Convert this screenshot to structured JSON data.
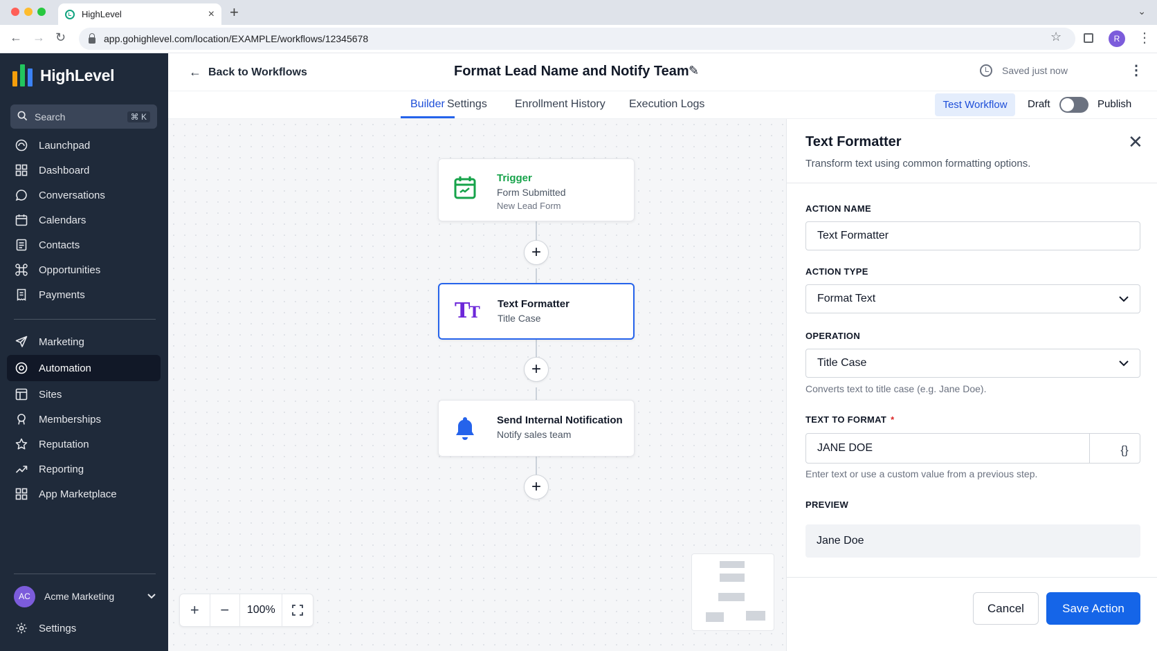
{
  "browser": {
    "tab_title": "HighLevel",
    "tab_close": "×",
    "new_tab": "+",
    "url": "app.gohighlevel.com/location/EXAMPLE/workflows/12345678",
    "profile_initial": "R"
  },
  "sidebar": {
    "brand": "HighLevel",
    "search_label": "Search",
    "search_shortcut": "⌘ K",
    "items": [
      {
        "label": "Launchpad",
        "icon": "launchpad-icon"
      },
      {
        "label": "Dashboard",
        "icon": "dashboard-icon"
      },
      {
        "label": "Conversations",
        "icon": "chat-icon"
      },
      {
        "label": "Calendars",
        "icon": "calendar-icon"
      },
      {
        "label": "Contacts",
        "icon": "contacts-icon"
      },
      {
        "label": "Opportunities",
        "icon": "opportunities-icon"
      },
      {
        "label": "Payments",
        "icon": "payments-icon"
      },
      {
        "label": "Marketing",
        "icon": "send-icon"
      },
      {
        "label": "Automation",
        "icon": "automation-icon",
        "active": true
      },
      {
        "label": "Sites",
        "icon": "sites-icon"
      },
      {
        "label": "Memberships",
        "icon": "memberships-icon"
      },
      {
        "label": "Reputation",
        "icon": "star-icon"
      },
      {
        "label": "Reporting",
        "icon": "reporting-icon"
      },
      {
        "label": "App Marketplace",
        "icon": "apps-icon"
      }
    ],
    "account": {
      "initials": "AC",
      "name": "Acme Marketing"
    },
    "settings_label": "Settings"
  },
  "header": {
    "back_label": "Back to Workflows",
    "title": "Format Lead Name and Notify Team",
    "saved_status": "Saved just now"
  },
  "tabs": {
    "items": [
      "Builder",
      "Settings",
      "Enrollment History",
      "Execution Logs"
    ],
    "active": "Builder",
    "test_button": "Test Workflow",
    "draft_label": "Draft",
    "publish_label": "Publish",
    "published": false
  },
  "canvas": {
    "nodes": [
      {
        "title": "Trigger",
        "subtitle": "Form Submitted",
        "detail": "New Lead Form",
        "icon": "calendar-check-icon"
      },
      {
        "title": "Text Formatter",
        "subtitle": "Title Case",
        "icon": "text-format-icon",
        "selected": true
      },
      {
        "title": "Send Internal Notification",
        "subtitle": "Notify sales team",
        "icon": "bell-icon"
      }
    ],
    "add_step": "+",
    "zoom": {
      "in": "+",
      "out": "−",
      "level": "100%"
    }
  },
  "panel": {
    "title": "Text Formatter",
    "description": "Transform text using common formatting options.",
    "action_name_label": "ACTION NAME",
    "action_name_value": "Text Formatter",
    "action_type_label": "ACTION TYPE",
    "action_type_value": "Format Text",
    "operation_label": "OPERATION",
    "operation_value": "Title Case",
    "operation_hint": "Converts text to title case (e.g. Jane Doe).",
    "text_label": "TEXT TO FORMAT",
    "required_mark": "*",
    "text_value": "JANE DOE",
    "custom_value_button": "{}",
    "text_hint": "Enter text or use a custom value from a previous step.",
    "preview_label": "PREVIEW",
    "preview_value": "Jane Doe",
    "cancel_label": "Cancel",
    "save_label": "Save Action"
  },
  "colors": {
    "sidebar_bg": "#1f2a3a",
    "accent_blue": "#1565e8",
    "trigger_green": "#16a34a",
    "formatter_purple": "#6d28d9"
  }
}
